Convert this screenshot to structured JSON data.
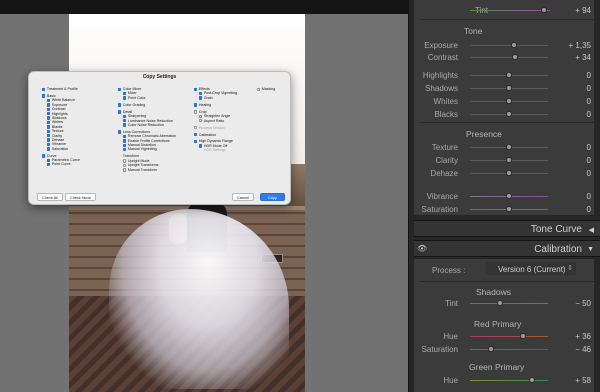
{
  "dialog": {
    "title": "Copy Settings",
    "col1": [
      {
        "label": "Treatment & Profile",
        "on": true,
        "level": 0
      },
      {
        "gap": true
      },
      {
        "label": "Basic",
        "on": true,
        "level": 0
      },
      {
        "label": "White Balance",
        "on": true,
        "level": 1
      },
      {
        "label": "Exposure",
        "on": true,
        "level": 1
      },
      {
        "label": "Contrast",
        "on": true,
        "level": 1
      },
      {
        "label": "Highlights",
        "on": true,
        "level": 1
      },
      {
        "label": "Shadows",
        "on": true,
        "level": 1
      },
      {
        "label": "Whites",
        "on": true,
        "level": 1
      },
      {
        "label": "Blacks",
        "on": true,
        "level": 1
      },
      {
        "label": "Texture",
        "on": true,
        "level": 1
      },
      {
        "label": "Clarity",
        "on": true,
        "level": 1
      },
      {
        "label": "Dehaze",
        "on": true,
        "level": 1
      },
      {
        "label": "Vibrance",
        "on": true,
        "level": 1
      },
      {
        "label": "Saturation",
        "on": true,
        "level": 1
      },
      {
        "gap": true
      },
      {
        "label": "Curve",
        "on": true,
        "level": 0
      },
      {
        "label": "Parametric Curve",
        "on": true,
        "level": 1
      },
      {
        "label": "Point Curve",
        "on": true,
        "level": 1
      }
    ],
    "col2": [
      {
        "label": "Color Mixer",
        "on": true,
        "level": 0
      },
      {
        "label": "Mixer",
        "on": true,
        "level": 1
      },
      {
        "label": "Point Color",
        "on": true,
        "level": 1
      },
      {
        "gap": true
      },
      {
        "label": "Color Grading",
        "on": true,
        "level": 0
      },
      {
        "gap": true
      },
      {
        "label": "Detail",
        "on": true,
        "level": 0
      },
      {
        "label": "Sharpening",
        "on": true,
        "level": 1
      },
      {
        "label": "Luminance Noise Reduction",
        "on": true,
        "level": 1
      },
      {
        "label": "Color Noise Reduction",
        "on": true,
        "level": 1
      },
      {
        "gap": true
      },
      {
        "label": "Lens Corrections",
        "on": true,
        "level": 0
      },
      {
        "label": "Remove Chromatic Aberration",
        "on": true,
        "level": 1
      },
      {
        "label": "Enable Profile Corrections",
        "on": true,
        "level": 1
      },
      {
        "label": "Manual Distortion",
        "on": true,
        "level": 1
      },
      {
        "label": "Manual Vignetting",
        "on": true,
        "level": 1
      },
      {
        "gap": true
      },
      {
        "label": "Transform",
        "on": false,
        "level": 0,
        "nobox": true
      },
      {
        "label": "Upright Mode",
        "on": false,
        "level": 1
      },
      {
        "label": "Upright Transforms",
        "on": false,
        "level": 1
      },
      {
        "label": "Manual Transform",
        "on": false,
        "level": 1
      }
    ],
    "col3": [
      {
        "label": "Effects",
        "on": true,
        "level": 0
      },
      {
        "label": "Post-Crop Vignetting",
        "on": true,
        "level": 1
      },
      {
        "label": "Grain",
        "on": true,
        "level": 1
      },
      {
        "gap": true
      },
      {
        "label": "Healing",
        "on": true,
        "level": 0
      },
      {
        "gap": true
      },
      {
        "label": "Crop",
        "on": false,
        "level": 0
      },
      {
        "label": "Straighten Angle",
        "on": false,
        "level": 1
      },
      {
        "label": "Aspect Ratio",
        "on": false,
        "level": 1
      },
      {
        "gap": true
      },
      {
        "label": "Process Version",
        "on": false,
        "level": 0,
        "dim": true
      },
      {
        "gap": true
      },
      {
        "label": "Calibration",
        "on": true,
        "level": 0
      },
      {
        "gap": true
      },
      {
        "label": "High Dynamic Range",
        "on": true,
        "level": 0
      },
      {
        "label": "HDR Mode Off",
        "on": true,
        "level": 1
      },
      {
        "label": "HDR Settings",
        "on": false,
        "level": 1,
        "dim": true,
        "nobox": true
      }
    ],
    "col4": [
      {
        "label": "Masking",
        "on": false,
        "level": 0
      }
    ],
    "check_all": "Check All",
    "check_none": "Check None",
    "cancel": "Cancel",
    "copy": "Copy"
  },
  "panel": {
    "tint_top": {
      "label": "Tint",
      "value": "+ 94",
      "pos": 0.93
    },
    "tone": {
      "title": "Tone",
      "sliders": [
        {
          "label": "Exposure",
          "value": "+ 1,35",
          "pos": 0.56
        },
        {
          "label": "Contrast",
          "value": "+ 34",
          "pos": 0.58
        },
        {
          "label": "Highlights",
          "value": "0",
          "pos": 0.5
        },
        {
          "label": "Shadows",
          "value": "0",
          "pos": 0.5
        },
        {
          "label": "Whites",
          "value": "0",
          "pos": 0.5
        },
        {
          "label": "Blacks",
          "value": "0",
          "pos": 0.5
        }
      ]
    },
    "presence": {
      "title": "Presence",
      "sliders": [
        {
          "label": "Texture",
          "value": "0",
          "pos": 0.5
        },
        {
          "label": "Clarity",
          "value": "0",
          "pos": 0.5
        },
        {
          "label": "Dehaze",
          "value": "0",
          "pos": 0.5
        },
        {
          "label": "Vibrance",
          "value": "0",
          "pos": 0.5
        },
        {
          "label": "Saturation",
          "value": "0",
          "pos": 0.5
        }
      ]
    },
    "tone_curve": "Tone Curve",
    "calibration": "Calibration",
    "process_label": "Process :",
    "process_value": "Version 6 (Current)",
    "shadows_title": "Shadows",
    "shadows_tint": {
      "label": "Tint",
      "value": "− 50",
      "pos": 0.38
    },
    "red_title": "Red Primary",
    "red_hue": {
      "label": "Hue",
      "value": "+ 36",
      "pos": 0.68
    },
    "red_sat": {
      "label": "Saturation",
      "value": "− 46",
      "pos": 0.27
    },
    "green_title": "Green Primary",
    "green_hue": {
      "label": "Hue",
      "value": "+ 58",
      "pos": 0.79
    }
  }
}
